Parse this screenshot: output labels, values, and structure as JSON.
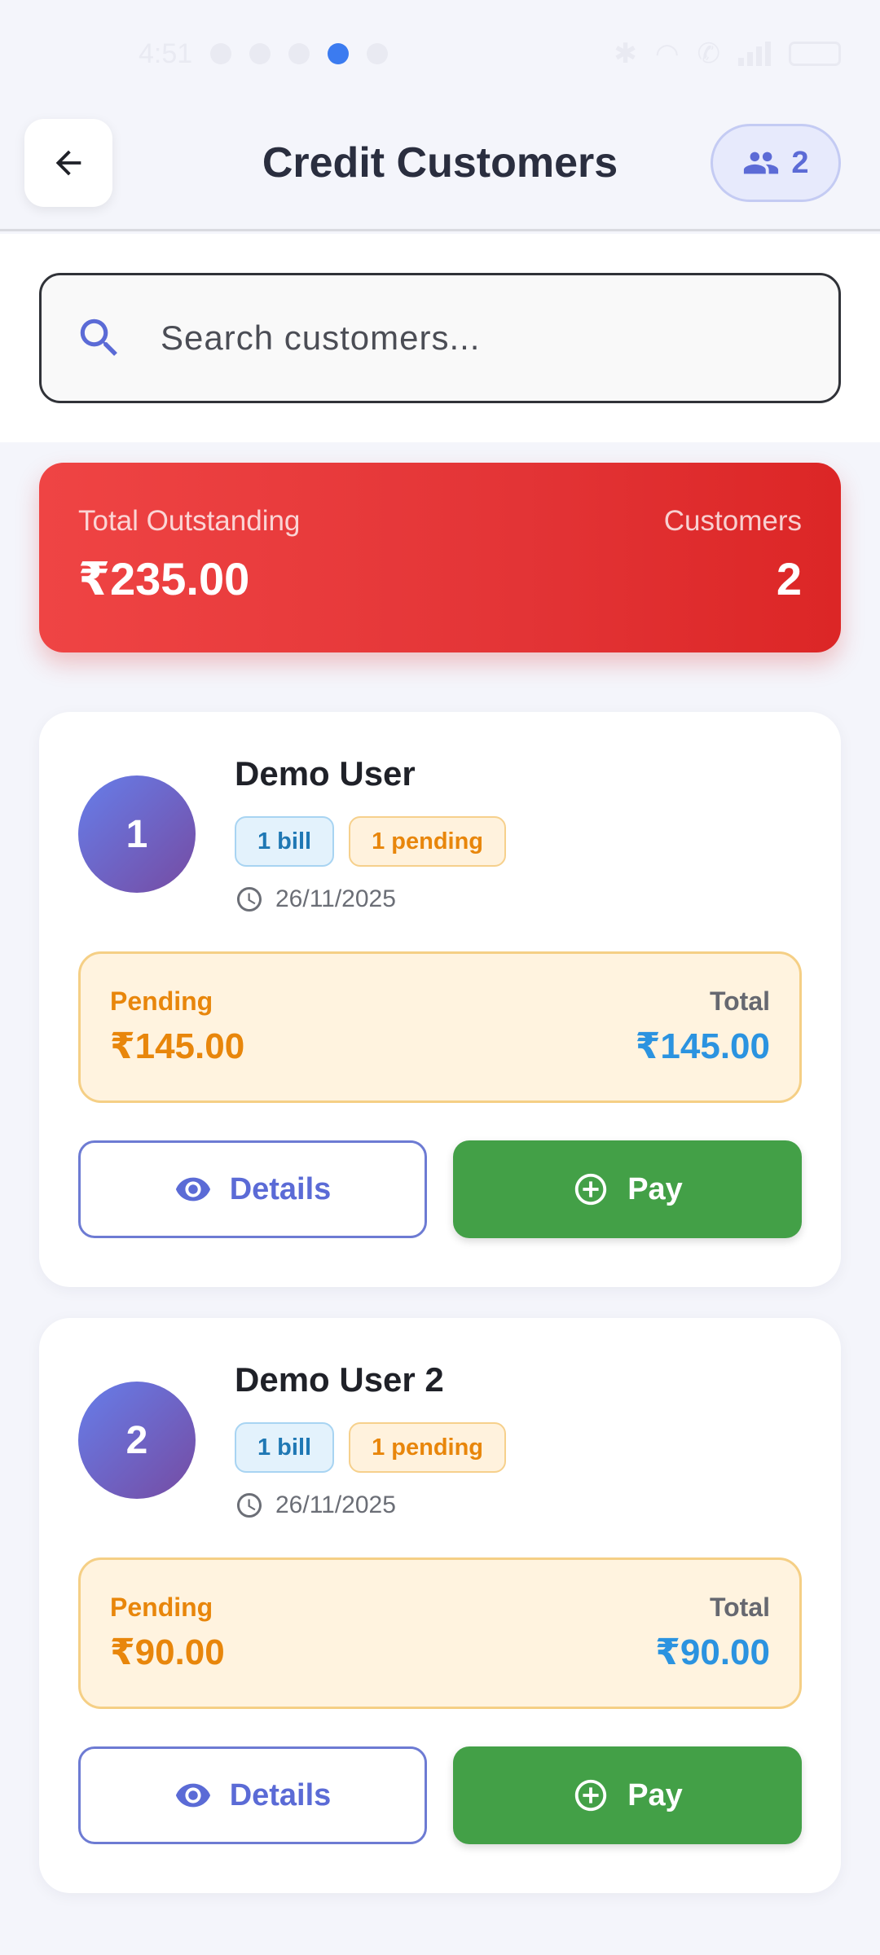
{
  "status_bar": {
    "time": "4:51"
  },
  "header": {
    "title": "Credit Customers",
    "customer_count": "2"
  },
  "search": {
    "placeholder": "Search customers..."
  },
  "summary": {
    "outstanding_label": "Total Outstanding",
    "outstanding_value": "₹235.00",
    "customers_label": "Customers",
    "customers_value": "2"
  },
  "customers": [
    {
      "avatar": "1",
      "name": "Demo User",
      "bills_badge": "1 bill",
      "pending_badge": "1 pending",
      "date": "26/11/2025",
      "pending_label": "Pending",
      "pending_amount": "₹145.00",
      "total_label": "Total",
      "total_amount": "₹145.00",
      "details_label": "Details",
      "pay_label": "Pay"
    },
    {
      "avatar": "2",
      "name": "Demo User 2",
      "bills_badge": "1 bill",
      "pending_badge": "1 pending",
      "date": "26/11/2025",
      "pending_label": "Pending",
      "pending_amount": "₹90.00",
      "total_label": "Total",
      "total_amount": "₹90.00",
      "details_label": "Details",
      "pay_label": "Pay"
    }
  ],
  "colors": {
    "summary_red": "#ef4444",
    "pay_green": "#43a047",
    "pending_orange": "#e8860b",
    "total_blue": "#2b93e0",
    "accent_indigo": "#5b6bd6"
  }
}
